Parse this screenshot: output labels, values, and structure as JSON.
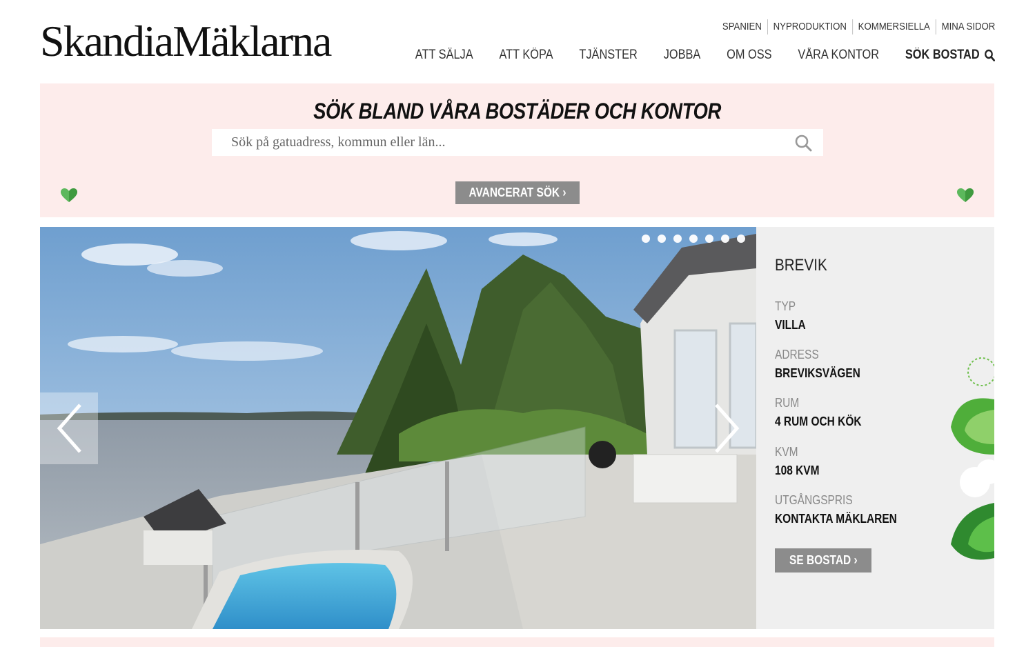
{
  "brand": {
    "logo_text": "SkandiaMäklarna"
  },
  "top_nav": [
    "SPANIEN",
    "NYPRODUKTION",
    "KOMMERSIELLA",
    "MINA SIDOR"
  ],
  "main_nav": [
    "ATT SÄLJA",
    "ATT KÖPA",
    "TJÄNSTER",
    "JOBBA",
    "OM OSS",
    "VÅRA KONTOR"
  ],
  "main_nav_search": "SÖK BOSTAD",
  "search": {
    "title": "SÖK BLAND VÅRA BOSTÄDER OCH KONTOR",
    "placeholder": "Sök på gatuadress, kommun eller län...",
    "value": "",
    "advanced_label": "AVANCERAT SÖK ›"
  },
  "slider": {
    "slide_count": 7,
    "active_index": 6
  },
  "listing": {
    "area": "BREVIK",
    "type_label": "TYP",
    "type_value": "VILLA",
    "address_label": "ADRESS",
    "address_value": "BREVIKSVÄGEN",
    "rooms_label": "RUM",
    "rooms_value": "4 RUM OCH KÖK",
    "size_label": "KVM",
    "size_value": "108 KVM",
    "price_label": "UTGÅNGSPRIS",
    "price_value": "KONTAKTA MÄKLAREN",
    "cta_label": "SE BOSTAD ›"
  },
  "colors": {
    "accent_pink": "#fdeceb",
    "button_gray": "#8c8c8c",
    "panel_gray": "#efefef",
    "heart_green": "#5cb85c"
  }
}
